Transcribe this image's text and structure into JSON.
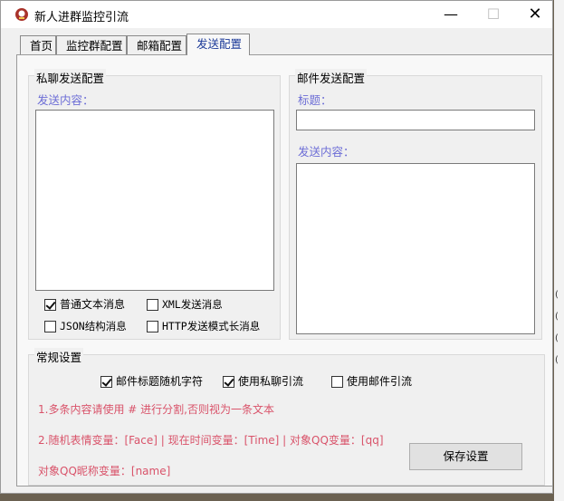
{
  "window": {
    "title": "新人进群监控引流"
  },
  "title_controls": {
    "minimize": "—",
    "maximize": "☐",
    "close": "✕"
  },
  "tabs": [
    {
      "label": "首页"
    },
    {
      "label": "监控群配置"
    },
    {
      "label": "邮箱配置"
    },
    {
      "label": "发送配置"
    }
  ],
  "private_msg": {
    "group_title": "私聊发送配置",
    "content_label": "发送内容：",
    "content_value": "",
    "options": [
      {
        "label": "普通文本消息",
        "checked": true
      },
      {
        "label": "XML发送消息",
        "checked": false
      },
      {
        "label": "JSON结构消息",
        "checked": false
      },
      {
        "label": "HTTP发送模式长消息",
        "checked": false
      }
    ]
  },
  "email": {
    "group_title": "邮件发送配置",
    "subject_label": "标题：",
    "subject_value": "",
    "content_label": "发送内容：",
    "content_value": ""
  },
  "general": {
    "group_title": "常规设置",
    "options": [
      {
        "label": "邮件标题随机字符",
        "checked": true
      },
      {
        "label": "使用私聊引流",
        "checked": true
      },
      {
        "label": "使用邮件引流",
        "checked": false
      }
    ],
    "hint1": "1.多条内容请使用 # 进行分割,否则视为一条文本",
    "hint2": "2.随机表情变量：[Face]  |  现在时间变量：[Time] | 对象QQ变量：[qq]",
    "hint3": "对象QQ昵称变量：[name]",
    "save_label": "保存设置"
  },
  "desktop_ticks": [
    "(",
    "(",
    "(",
    "("
  ],
  "colors": {
    "accent_blue": "#6c6dd6",
    "hint_red": "#d9536a",
    "tab_active_text": "#1c3a99"
  }
}
